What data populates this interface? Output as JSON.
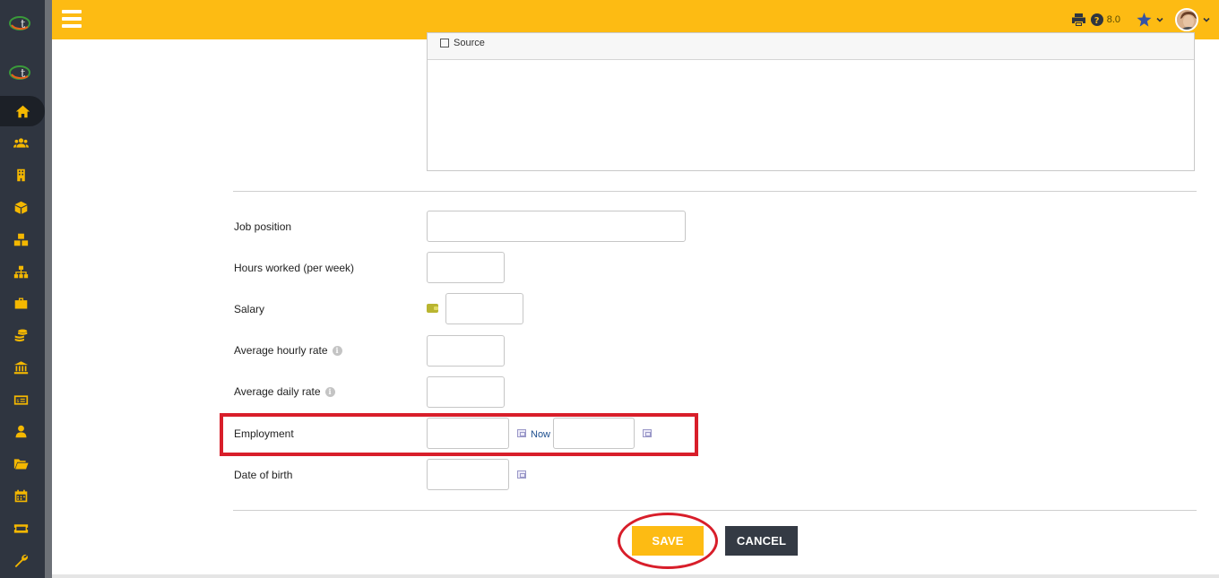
{
  "header": {
    "version": "8.0"
  },
  "editor": {
    "source_label": "Source"
  },
  "form": {
    "job_position_label": "Job position",
    "hours_worked_label": "Hours worked (per week)",
    "salary_label": "Salary",
    "avg_hourly_rate_label": "Average hourly rate",
    "avg_daily_rate_label": "Average daily rate",
    "employment_label": "Employment",
    "employment_now_link": "Now",
    "date_of_birth_label": "Date of birth",
    "info_glyph": "i"
  },
  "actions": {
    "save_label": "SAVE",
    "cancel_label": "CANCEL"
  },
  "sidebar": {
    "icons": [
      "home-icon",
      "users-icon",
      "building-icon",
      "box-icon",
      "boxes-icon",
      "org-chart-icon",
      "briefcase-icon",
      "coins-icon",
      "bank-icon",
      "money-bill-icon",
      "user-tie-icon",
      "folder-open-icon",
      "calendar-icon",
      "ticket-icon",
      "wrench-icon"
    ]
  },
  "colors": {
    "accent": "#fdbb13",
    "sidebar": "#2f3540",
    "highlight": "#d81e2a",
    "cancel": "#343a44"
  }
}
